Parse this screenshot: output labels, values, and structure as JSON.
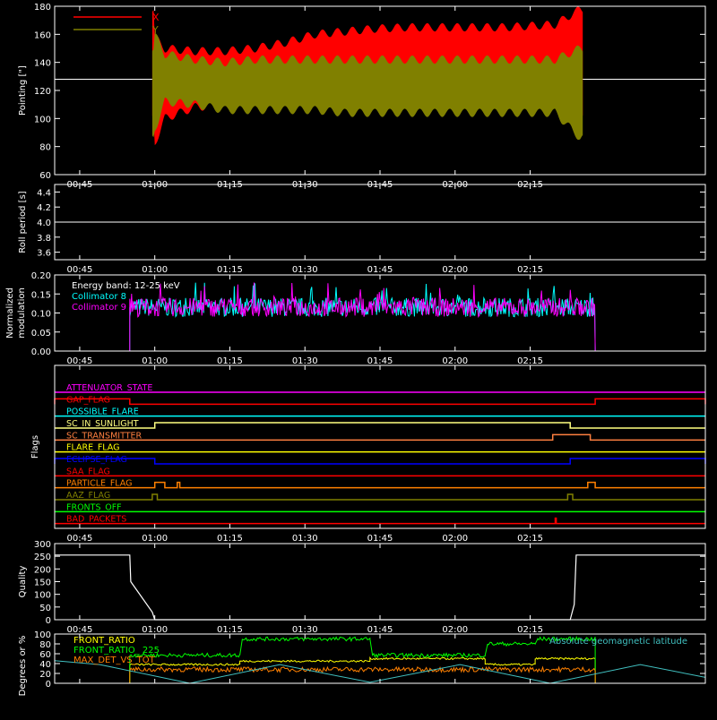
{
  "chart_data": [
    {
      "type": "area",
      "panel": "pointing",
      "ylabel": "Pointing [\"]",
      "ylim": [
        60,
        180
      ],
      "yticks": [
        60,
        80,
        100,
        120,
        140,
        160,
        180
      ],
      "xlim_min": [
        40,
        170
      ],
      "xticks": [
        "00:45",
        "01:00",
        "01:15",
        "01:30",
        "01:45",
        "02:00",
        "02:15"
      ],
      "xtick_min": [
        45,
        60,
        75,
        90,
        105,
        120,
        135
      ],
      "legend": [
        {
          "name": "X",
          "color": "#ff0000"
        },
        {
          "name": "Y",
          "color": "#808000"
        }
      ],
      "reference_line": 128,
      "data_start_min": 59.5,
      "data_end_min": 145.5,
      "series": [
        {
          "name": "X",
          "band_min": [
            82,
            100,
            108,
            110,
            110,
            112,
            118,
            118,
            118,
            120,
            120,
            122,
            122,
            100
          ],
          "band_max": [
            158,
            150,
            148,
            148,
            150,
            154,
            160,
            162,
            164,
            165,
            165,
            165,
            167,
            178
          ]
        },
        {
          "name": "Y",
          "band_min": [
            92,
            112,
            110,
            106,
            106,
            106,
            106,
            104,
            104,
            104,
            104,
            104,
            104,
            86
          ],
          "band_max": [
            160,
            146,
            142,
            140,
            142,
            142,
            142,
            142,
            142,
            142,
            142,
            142,
            142,
            150
          ]
        }
      ],
      "band_x_min": [
        60,
        62,
        68,
        74,
        80,
        86,
        92,
        98,
        104,
        110,
        120,
        130,
        140,
        145
      ]
    },
    {
      "type": "line",
      "panel": "roll-period",
      "ylabel": "Roll period [s]",
      "ylim": [
        3.5,
        4.5
      ],
      "yticks": [
        "3.6",
        "3.8",
        "4.0",
        "4.2",
        "4.4"
      ],
      "ytick_values": [
        3.6,
        3.8,
        4.0,
        4.2,
        4.4
      ],
      "value": 4.0,
      "xticks": [
        "00:45",
        "01:00",
        "01:15",
        "01:30",
        "01:45",
        "02:00",
        "02:15"
      ]
    },
    {
      "type": "line",
      "panel": "modulation",
      "ylabel": "Normalized modulation",
      "ylim": [
        0,
        0.2
      ],
      "yticks": [
        "0.00",
        "0.05",
        "0.10",
        "0.15",
        "0.20"
      ],
      "ytick_values": [
        0,
        0.05,
        0.1,
        0.15,
        0.2
      ],
      "annotation": "Energy band: 12-25 keV",
      "data_start_min": 55,
      "data_end_min": 148,
      "series": [
        {
          "name": "Collimator 8",
          "color": "#00ffff",
          "mean": 0.115
        },
        {
          "name": "Collimator 9",
          "color": "#ff00ff",
          "mean": 0.115
        }
      ],
      "xticks": [
        "00:45",
        "01:00",
        "01:15",
        "01:30",
        "01:45",
        "02:00",
        "02:15"
      ]
    },
    {
      "type": "line",
      "panel": "flags",
      "ylabel": "Flags",
      "flags": [
        {
          "name": "ATTENUATOR_STATE",
          "color": "#ff00ff",
          "segments": []
        },
        {
          "name": "GAP_FLAG",
          "color": "#ff0000",
          "segments": [
            [
              40,
              55
            ],
            [
              148,
              170
            ]
          ]
        },
        {
          "name": "POSSIBLE_FLARE",
          "color": "#00ffff",
          "segments": []
        },
        {
          "name": "SC_IN_SUNLIGHT",
          "color": "#ffff80",
          "segments": [
            [
              60,
              143
            ]
          ]
        },
        {
          "name": "SC_TRANSMITTER",
          "color": "#ff8040",
          "segments": [
            [
              139.5,
              147
            ]
          ]
        },
        {
          "name": "FLARE_FLAG",
          "color": "#ffff00",
          "segments": []
        },
        {
          "name": "ECLIPSE_FLAG",
          "color": "#0000ff",
          "segments": [
            [
              40,
              60
            ],
            [
              143,
              170
            ]
          ]
        },
        {
          "name": "SAA_FLAG",
          "color": "#ff0000",
          "segments": []
        },
        {
          "name": "PARTICLE_FLAG",
          "color": "#ff8000",
          "segments": [
            [
              60,
              62
            ],
            [
              64.5,
              65
            ],
            [
              146.5,
              148
            ]
          ]
        },
        {
          "name": "AAZ_FLAG",
          "color": "#808000",
          "segments": [
            [
              59.5,
              60.5
            ],
            [
              142.5,
              143.5
            ]
          ]
        },
        {
          "name": "FRONTS_OFF",
          "color": "#00ff00",
          "segments": []
        },
        {
          "name": "BAD_PACKETS",
          "color": "#ff0000",
          "segments": [
            [
              140,
              140.2
            ]
          ]
        }
      ],
      "xticks": [
        "00:45",
        "01:00",
        "01:15",
        "01:30",
        "01:45",
        "02:00",
        "02:15"
      ]
    },
    {
      "type": "line",
      "panel": "quality",
      "ylabel": "Quality",
      "ylim": [
        0,
        300
      ],
      "yticks": [
        "0",
        "50",
        "100",
        "150",
        "200",
        "250",
        "300"
      ],
      "ytick_values": [
        0,
        50,
        100,
        150,
        200,
        250,
        300
      ],
      "x": [
        40,
        55,
        55.2,
        59.5,
        60,
        143,
        143.8,
        144.2,
        170
      ],
      "y": [
        255,
        255,
        150,
        30,
        0,
        0,
        60,
        255,
        255
      ],
      "xticks": [
        "00:45",
        "01:00",
        "01:15",
        "01:30",
        "01:45",
        "02:00",
        "02:15"
      ]
    },
    {
      "type": "line",
      "panel": "ratios",
      "ylabel": "Degrees or %",
      "ylim": [
        0,
        100
      ],
      "yticks": [
        "0",
        "20",
        "40",
        "60",
        "80",
        "100"
      ],
      "ytick_values": [
        0,
        20,
        40,
        60,
        80,
        100
      ],
      "annotation": "Absolute geomagnetic latitude",
      "series": [
        {
          "name": "FRONT_RATIO",
          "color": "#ffff00",
          "x": [
            55,
            77,
            77,
            103,
            103,
            126,
            126,
            136,
            136,
            148
          ],
          "y": [
            38,
            38,
            45,
            45,
            50,
            50,
            38,
            38,
            50,
            50
          ]
        },
        {
          "name": "FRONT_RATIO_ 225",
          "color": "#00ff00",
          "x": [
            55,
            77,
            77.5,
            103,
            103.5,
            126,
            126.5,
            136,
            136.5,
            148
          ],
          "y": [
            57,
            57,
            90,
            90,
            57,
            57,
            80,
            80,
            90,
            90
          ]
        },
        {
          "name": "MAX_DET_VS_TOT",
          "color": "#ff8000",
          "x": [
            55,
            148
          ],
          "y": [
            28,
            28
          ]
        },
        {
          "name": "Absolute geomagnetic latitude",
          "color": "#40c0c0",
          "x": [
            40,
            49,
            67,
            85,
            103,
            121,
            139,
            157,
            170
          ],
          "y": [
            46,
            38,
            0,
            38,
            2,
            38,
            0,
            38,
            12
          ]
        }
      ],
      "xticks": [
        "00:45",
        "01:00",
        "01:15",
        "01:30",
        "01:45",
        "02:00",
        "02:15"
      ]
    }
  ]
}
